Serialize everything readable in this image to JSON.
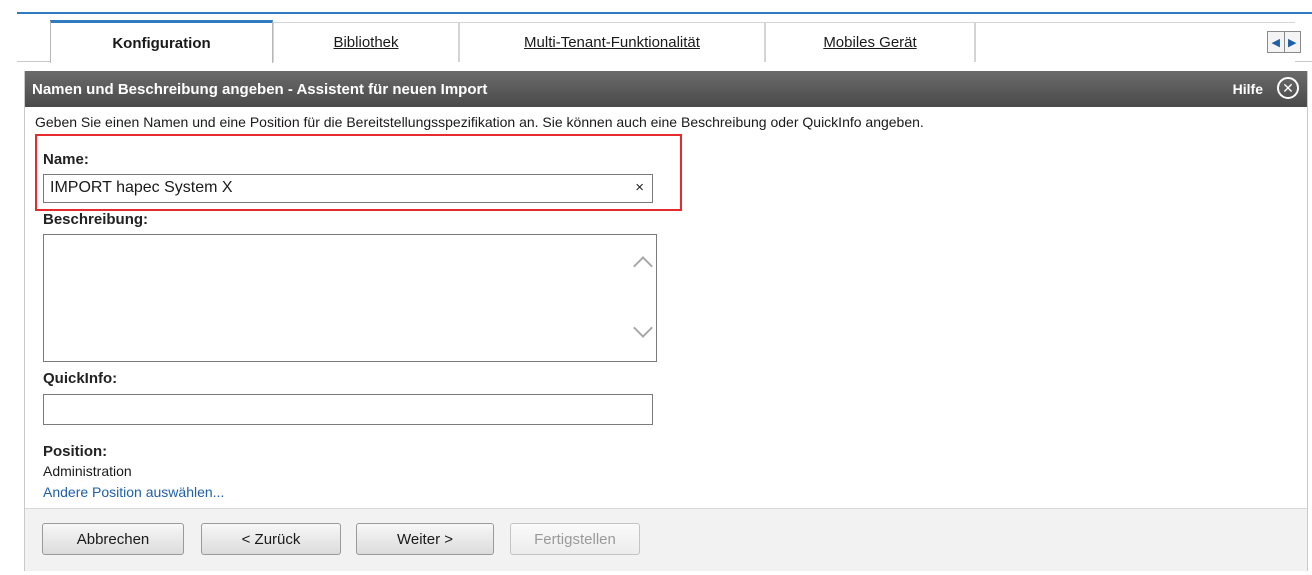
{
  "tabs": [
    {
      "label": "Konfiguration",
      "active": true
    },
    {
      "label": "Bibliothek",
      "active": false
    },
    {
      "label": "Multi-Tenant-Funktionalität",
      "active": false
    },
    {
      "label": "Mobiles Gerät",
      "active": false
    }
  ],
  "tab_scroll": {
    "left_icon": "◀",
    "right_icon": "▶"
  },
  "dialog": {
    "title": "Namen und Beschreibung angeben - Assistent für neuen Import",
    "help_label": "Hilfe",
    "close_icon": "close-circle-icon",
    "intro": "Geben Sie einen Namen und eine Position für die Bereitstellungsspezifikation an. Sie können auch eine Beschreibung oder QuickInfo angeben.",
    "name_label": "Name:",
    "name_value": "IMPORT hapec System X",
    "clear_icon": "×",
    "description_label": "Beschreibung:",
    "description_value": "",
    "quickinfo_label": "QuickInfo:",
    "quickinfo_value": "",
    "position_label": "Position:",
    "position_value": "Administration",
    "position_link": "Andere Position auswählen...",
    "buttons": {
      "cancel": "Abbrechen",
      "back": "< Zurück",
      "next": "Weiter >",
      "finish": "Fertigstellen"
    }
  },
  "colors": {
    "accent": "#2e7bbf",
    "titlebar": "#555555",
    "highlight": "#e52b2b",
    "link": "#1f5fa8"
  }
}
